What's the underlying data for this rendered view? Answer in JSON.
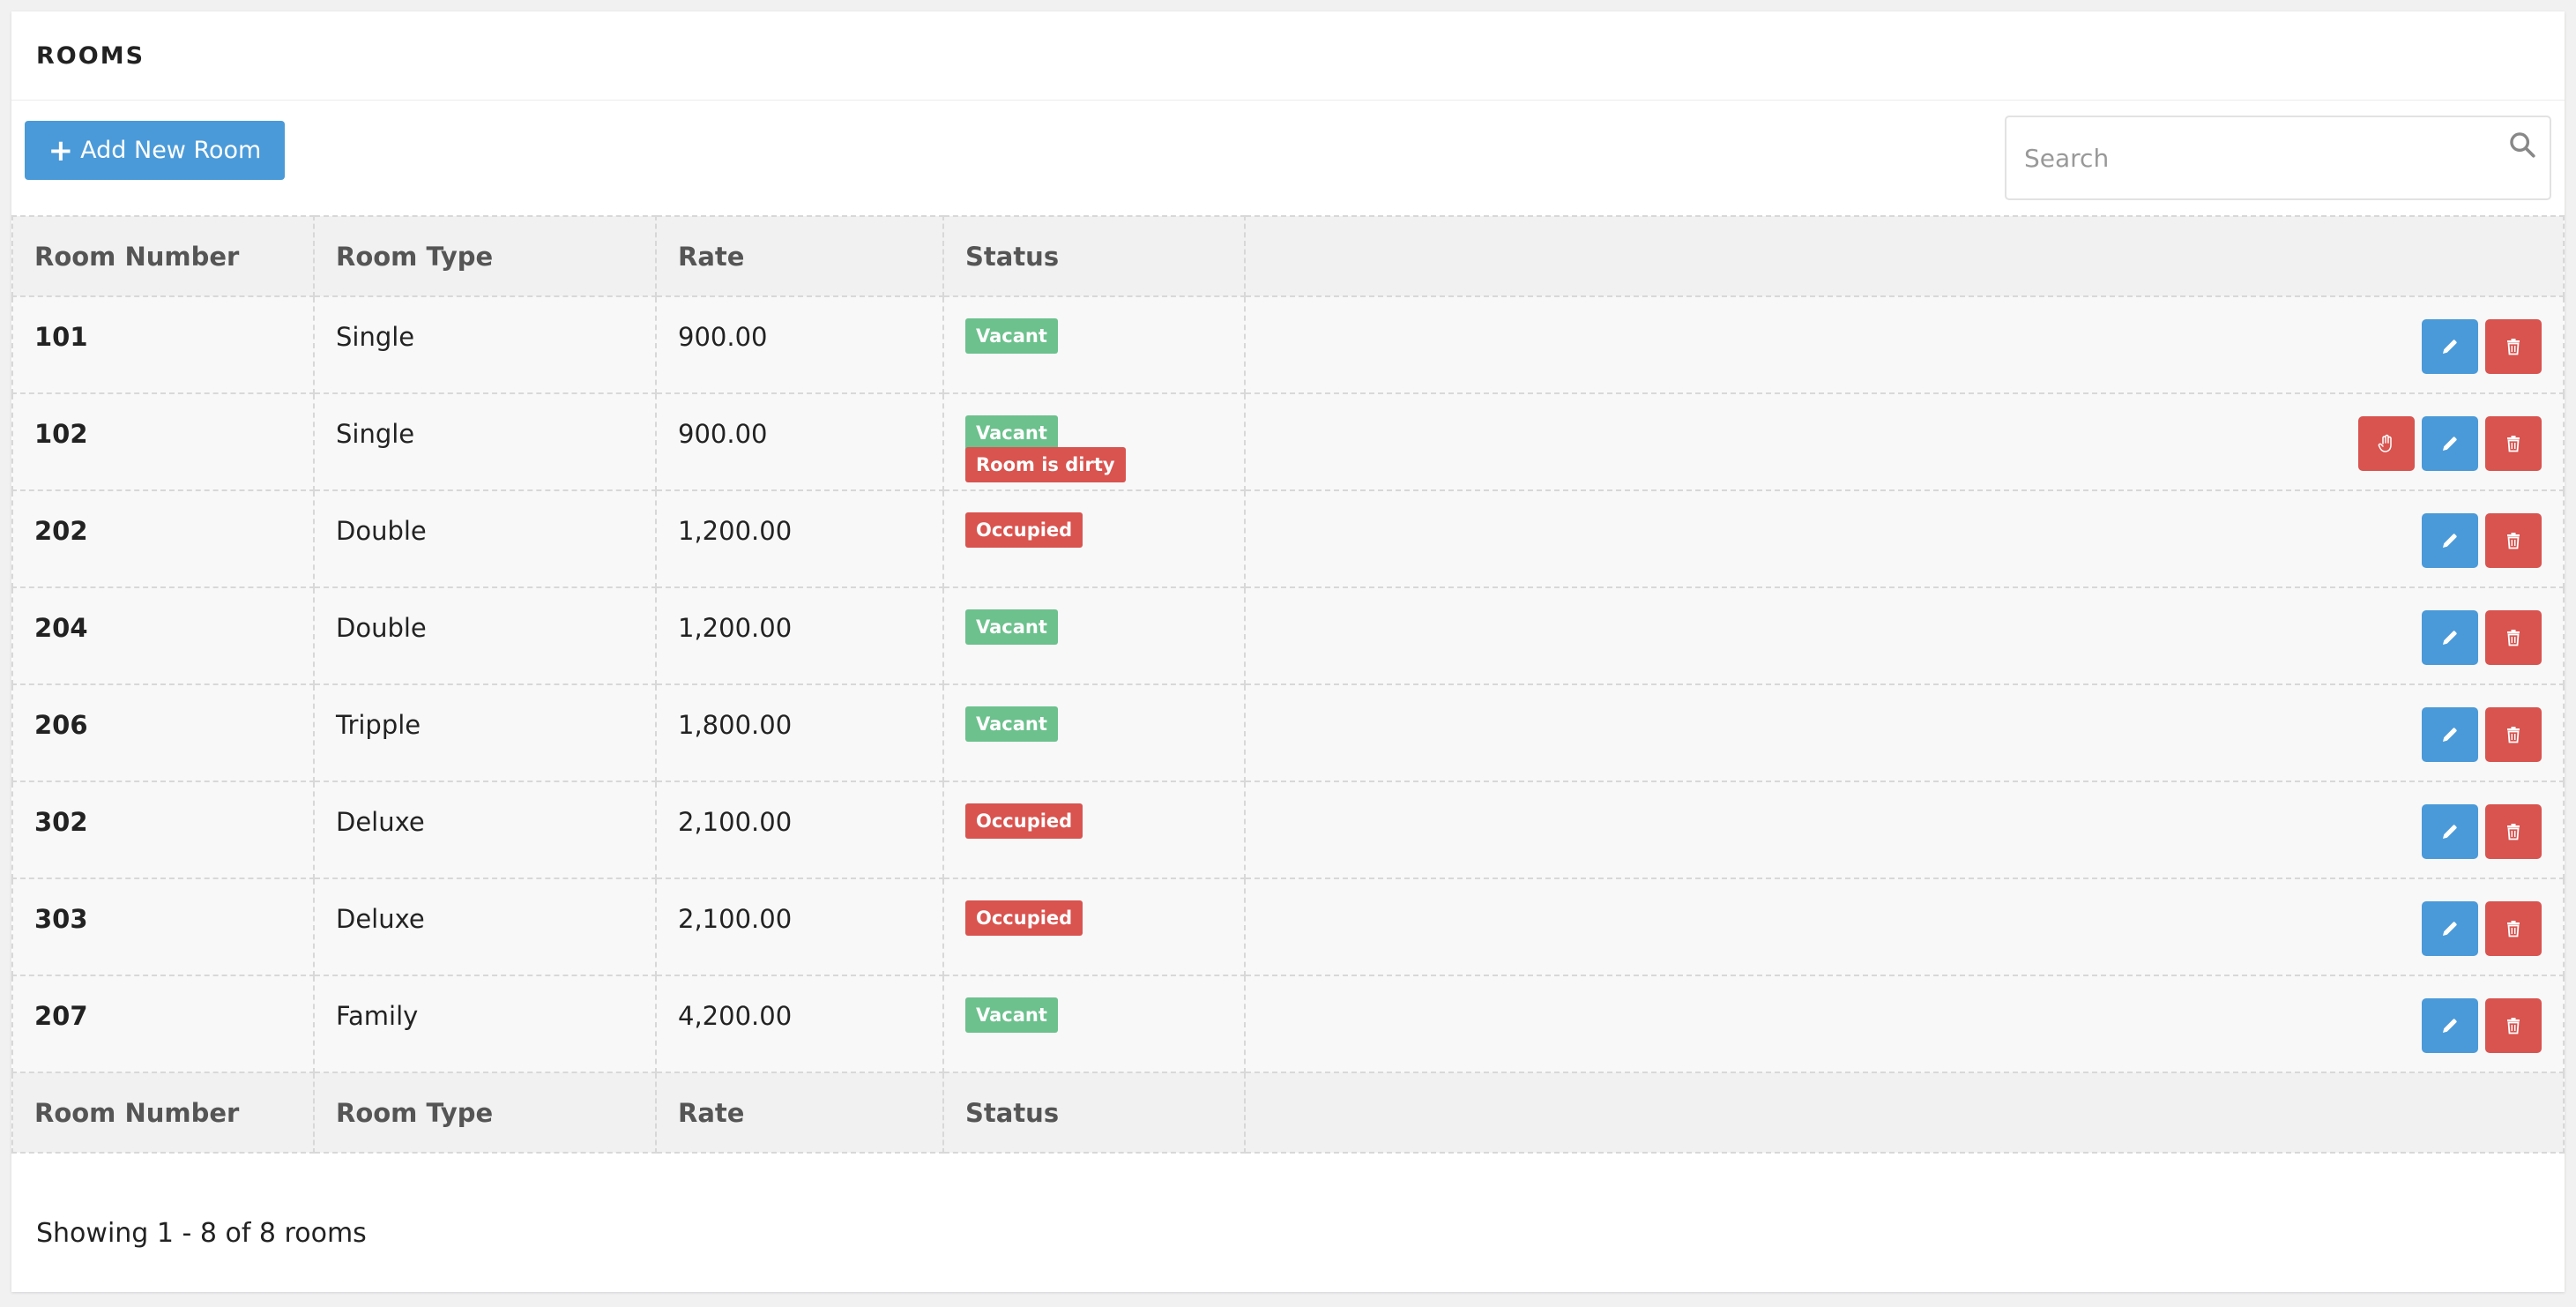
{
  "panel": {
    "title": "ROOMS"
  },
  "toolbar": {
    "add_label": "Add New Room",
    "search_placeholder": "Search",
    "search_value": ""
  },
  "colors": {
    "primary": "#4a9ad9",
    "danger": "#d9534f",
    "success": "#6cc18d"
  },
  "table": {
    "columns": [
      "Room Number",
      "Room Type",
      "Rate",
      "Status",
      ""
    ],
    "rows": [
      {
        "number": "101",
        "type": "Single",
        "rate": "900.00",
        "badges": [
          {
            "label": "Vacant",
            "kind": "success"
          }
        ],
        "actions": [
          "edit",
          "delete"
        ]
      },
      {
        "number": "102",
        "type": "Single",
        "rate": "900.00",
        "badges": [
          {
            "label": "Vacant",
            "kind": "success"
          },
          {
            "label": "Room is dirty",
            "kind": "danger"
          }
        ],
        "actions": [
          "clean",
          "edit",
          "delete"
        ]
      },
      {
        "number": "202",
        "type": "Double",
        "rate": "1,200.00",
        "badges": [
          {
            "label": "Occupied",
            "kind": "danger"
          }
        ],
        "actions": [
          "edit",
          "delete"
        ]
      },
      {
        "number": "204",
        "type": "Double",
        "rate": "1,200.00",
        "badges": [
          {
            "label": "Vacant",
            "kind": "success"
          }
        ],
        "actions": [
          "edit",
          "delete"
        ]
      },
      {
        "number": "206",
        "type": "Tripple",
        "rate": "1,800.00",
        "badges": [
          {
            "label": "Vacant",
            "kind": "success"
          }
        ],
        "actions": [
          "edit",
          "delete"
        ]
      },
      {
        "number": "302",
        "type": "Deluxe",
        "rate": "2,100.00",
        "badges": [
          {
            "label": "Occupied",
            "kind": "danger"
          }
        ],
        "actions": [
          "edit",
          "delete"
        ]
      },
      {
        "number": "303",
        "type": "Deluxe",
        "rate": "2,100.00",
        "badges": [
          {
            "label": "Occupied",
            "kind": "danger"
          }
        ],
        "actions": [
          "edit",
          "delete"
        ]
      },
      {
        "number": "207",
        "type": "Family",
        "rate": "4,200.00",
        "badges": [
          {
            "label": "Vacant",
            "kind": "success"
          }
        ],
        "actions": [
          "edit",
          "delete"
        ]
      }
    ]
  },
  "icons": {
    "add": "plus-icon",
    "search": "search-icon",
    "clean": "hand-icon",
    "edit": "pencil-icon",
    "delete": "trash-icon"
  },
  "footer": {
    "text": "Showing 1 - 8 of 8 rooms"
  }
}
